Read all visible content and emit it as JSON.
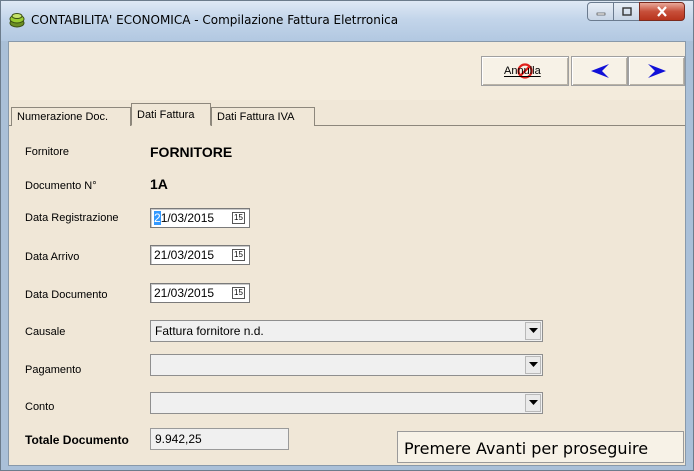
{
  "window": {
    "title": "CONTABILITA' ECONOMICA - Compilazione Fattura Eletrronica"
  },
  "toolbar": {
    "annulla_label": "Annulla"
  },
  "tabs": [
    {
      "label": "Numerazione Doc."
    },
    {
      "label": "Dati Fattura"
    },
    {
      "label": "Dati Fattura IVA"
    }
  ],
  "form": {
    "fornitore_label": "Fornitore",
    "fornitore_value": "FORNITORE",
    "documento_label": "Documento N°",
    "documento_value": "1A",
    "data_registrazione_label": "Data Registrazione",
    "data_registrazione_sel": "2",
    "data_registrazione_rest": "1/03/2015",
    "data_arrivo_label": "Data Arrivo",
    "data_arrivo_value": "21/03/2015",
    "data_documento_label": "Data Documento",
    "data_documento_value": "21/03/2015",
    "calendar_glyph": "15",
    "causale_label": "Causale",
    "causale_value": "Fattura fornitore n.d.",
    "pagamento_label": "Pagamento",
    "pagamento_value": "",
    "conto_label": "Conto",
    "conto_value": "",
    "totale_label": "Totale Documento",
    "totale_value": "9.942,25"
  },
  "hint": "Premere Avanti per proseguire",
  "colors": {
    "annulla_icon": "#e0201b",
    "arrow_icon": "#1010d8"
  }
}
